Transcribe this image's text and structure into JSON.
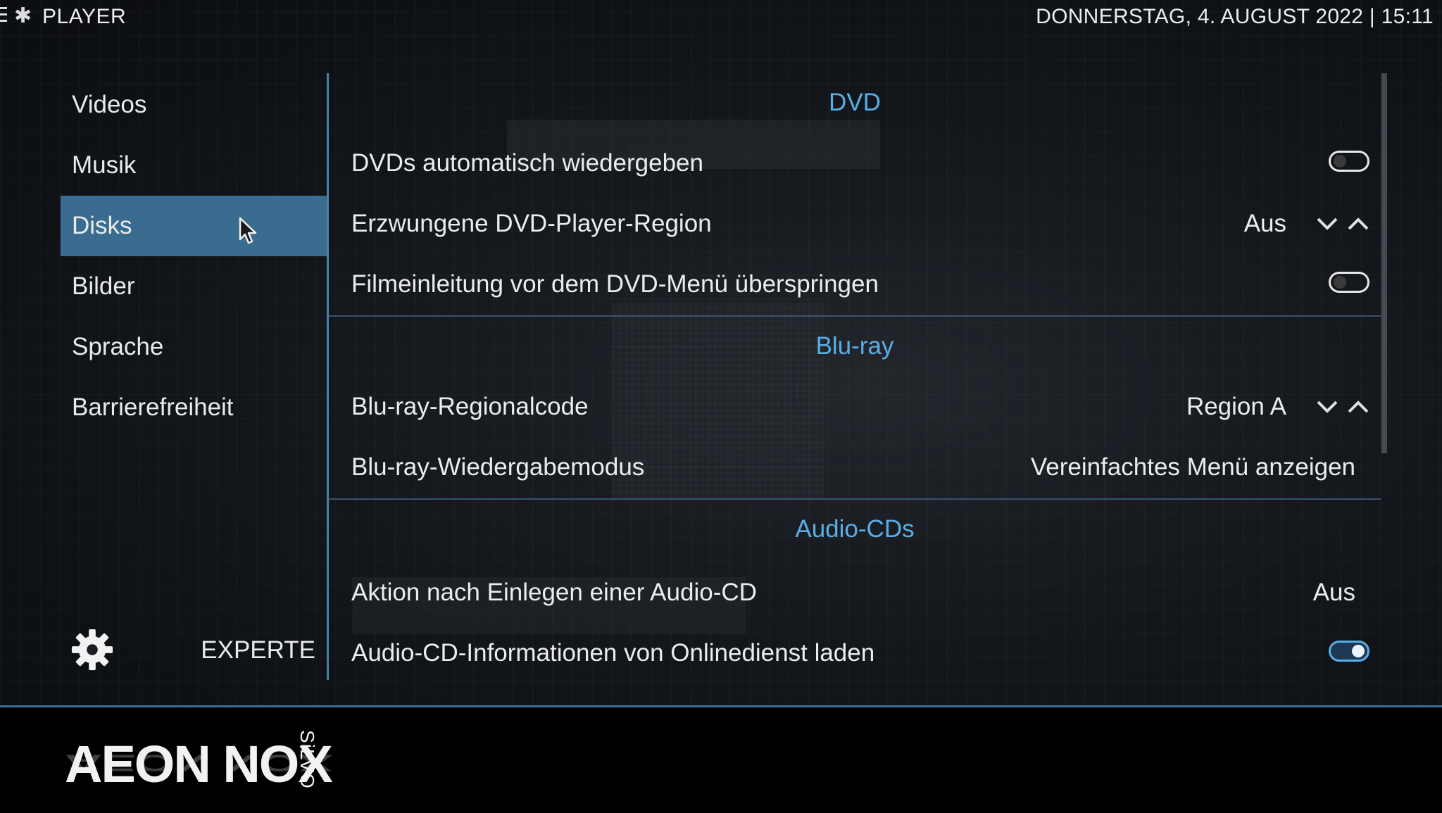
{
  "topbar": {
    "section_title": "PLAYER",
    "datetime": "DONNERSTAG, 4. AUGUST 2022 | 15:11"
  },
  "sidebar": {
    "items": [
      {
        "label": "Videos",
        "active": false
      },
      {
        "label": "Musik",
        "active": false
      },
      {
        "label": "Disks",
        "active": true
      },
      {
        "label": "Bilder",
        "active": false
      },
      {
        "label": "Sprache",
        "active": false
      },
      {
        "label": "Barrierefreiheit",
        "active": false
      }
    ],
    "settings_level": "EXPERTE"
  },
  "settings": {
    "dvd_header": "DVD",
    "dvd_autoplay": {
      "label": "DVDs automatisch wiedergeben",
      "enabled": false
    },
    "dvd_region": {
      "label": "Erzwungene DVD-Player-Region",
      "value": "Aus"
    },
    "dvd_skip_intro": {
      "label": "Filmeinleitung vor dem DVD-Menü überspringen",
      "enabled": false
    },
    "bluray_header": "Blu-ray",
    "bluray_region": {
      "label": "Blu-ray-Regionalcode",
      "value": "Region A"
    },
    "bluray_playback": {
      "label": "Blu-ray-Wiedergabemodus",
      "value": "Vereinfachtes Menü anzeigen"
    },
    "audiocd_header": "Audio-CDs",
    "audiocd_action": {
      "label": "Aktion nach Einlegen einer Audio-CD",
      "value": "Aus"
    },
    "audiocd_online": {
      "label": "Audio-CD-Informationen von Onlinedienst laden",
      "enabled": true
    }
  },
  "branding": {
    "logo_main": "AEON NOX",
    "logo_sub": "SiLVO"
  },
  "colors": {
    "accent": "#5aaee8",
    "highlight": "#3a6c90",
    "divider": "#36546c"
  },
  "icons": [
    "menu-icon",
    "player-icon",
    "gear-icon",
    "chevron-down-icon",
    "chevron-up-icon",
    "mouse-cursor-icon"
  ]
}
